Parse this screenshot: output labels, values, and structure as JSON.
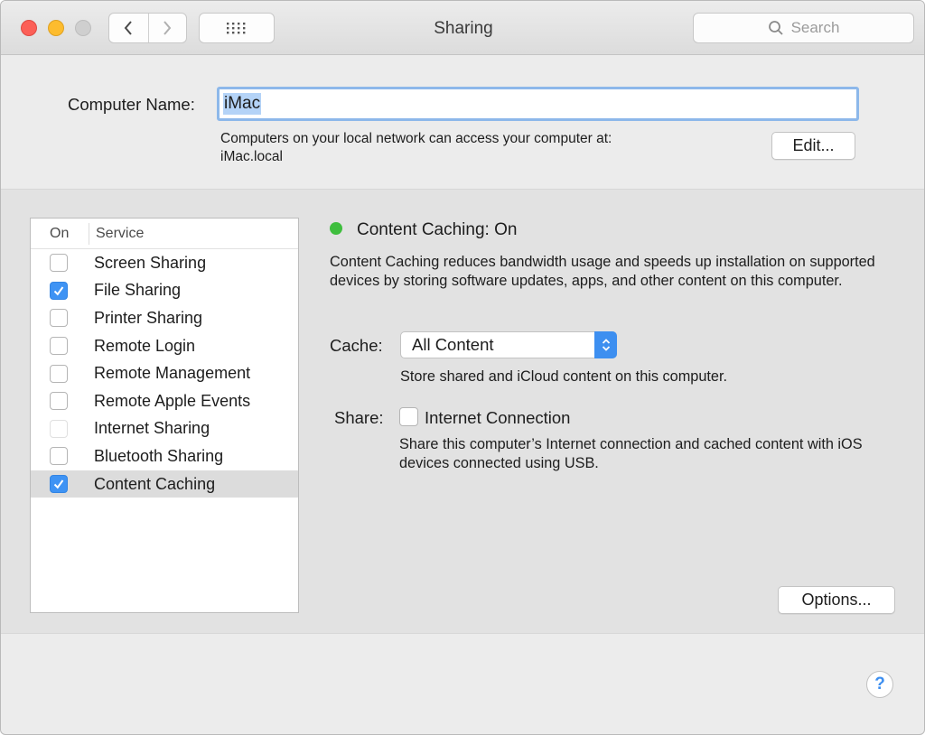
{
  "window": {
    "title": "Sharing",
    "search_placeholder": "Search"
  },
  "computer_name": {
    "label": "Computer Name:",
    "value": "iMac",
    "caption_line1": "Computers on your local network can access your computer at:",
    "caption_line2": "iMac.local",
    "edit_label": "Edit..."
  },
  "services": {
    "header_on": "On",
    "header_service": "Service",
    "items": [
      {
        "label": "Screen Sharing",
        "checked": false
      },
      {
        "label": "File Sharing",
        "checked": true
      },
      {
        "label": "Printer Sharing",
        "checked": false
      },
      {
        "label": "Remote Login",
        "checked": false
      },
      {
        "label": "Remote Management",
        "checked": false
      },
      {
        "label": "Remote Apple Events",
        "checked": false
      },
      {
        "label": "Internet Sharing",
        "checked": false,
        "disabled": true
      },
      {
        "label": "Bluetooth Sharing",
        "checked": false
      },
      {
        "label": "Content Caching",
        "checked": true,
        "selected": true
      }
    ]
  },
  "detail": {
    "status": "Content Caching: On",
    "status_color": "#3fbe3e",
    "description": "Content Caching reduces bandwidth usage and speeds up installation on supported devices by storing software updates, apps, and other content on this computer.",
    "cache_label": "Cache:",
    "cache_value": "All Content",
    "cache_caption": "Store shared and iCloud content on this computer.",
    "share_label": "Share:",
    "share_option": "Internet Connection",
    "share_checked": false,
    "share_caption": "Share this computer’s Internet connection and cached content with iOS devices connected using USB.",
    "options_label": "Options..."
  },
  "help": {
    "label": "?"
  },
  "colors": {
    "accent": "#3d8ff0",
    "selection": "#b4d3f7"
  }
}
